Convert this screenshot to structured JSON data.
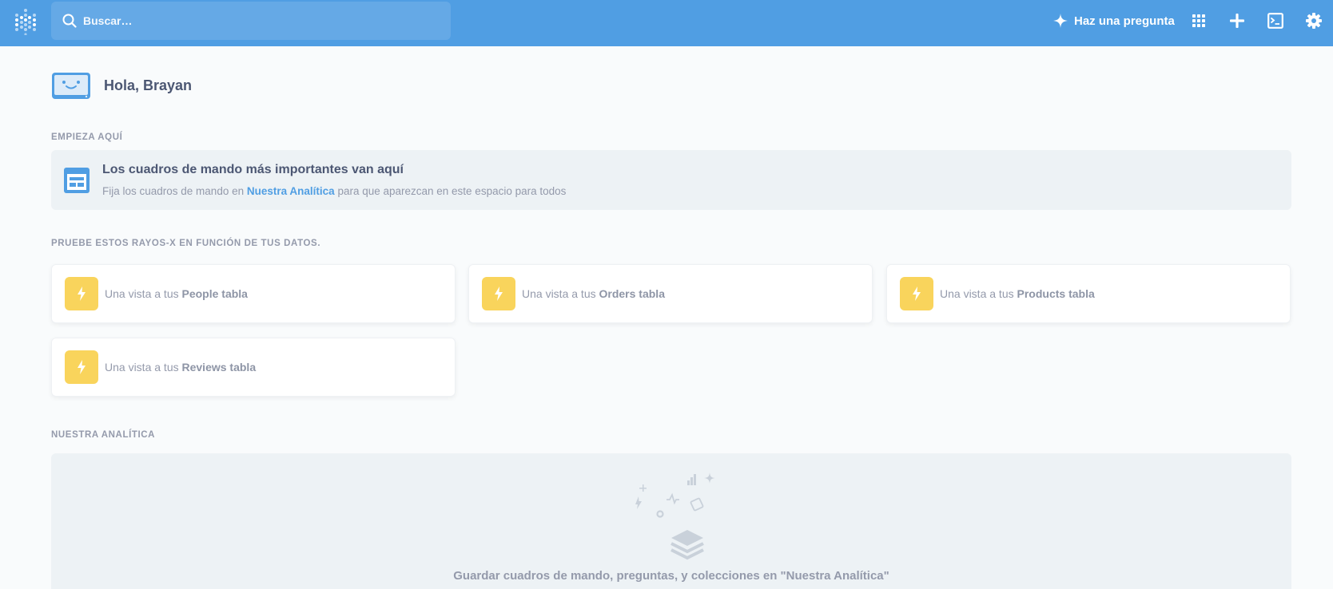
{
  "nav": {
    "search_placeholder": "Buscar…",
    "ask_label": "Haz una pregunta",
    "icons": [
      "sparkle-icon",
      "apps-grid-icon",
      "plus-icon",
      "notebook-icon",
      "gear-icon"
    ],
    "brand_color": "#509ee3"
  },
  "home": {
    "greeting": "Hola, Brayan"
  },
  "start_here": {
    "label": "EMPIEZA AQUÍ",
    "title": "Los cuadros de mando más importantes van aquí",
    "desc_before": "Fija los cuadros de mando en",
    "desc_link": "Nuestra Analítica",
    "desc_after": "para que aparezcan en este espacio para todos"
  },
  "xrays": {
    "label": "PRUEBE ESTOS RAYOS-X EN FUNCIÓN DE TUS DATOS.",
    "prefix": "Una vista a tus",
    "items": [
      {
        "name": "People tabla"
      },
      {
        "name": "Orders tabla"
      },
      {
        "name": "Products tabla"
      },
      {
        "name": "Reviews tabla"
      }
    ],
    "accent_color": "#f9d45c"
  },
  "our_analytics": {
    "label": "NUESTRA ANALÍTICA",
    "empty_text": "Guardar cuadros de mando, preguntas, y colecciones en \"Nuestra Analítica\""
  }
}
